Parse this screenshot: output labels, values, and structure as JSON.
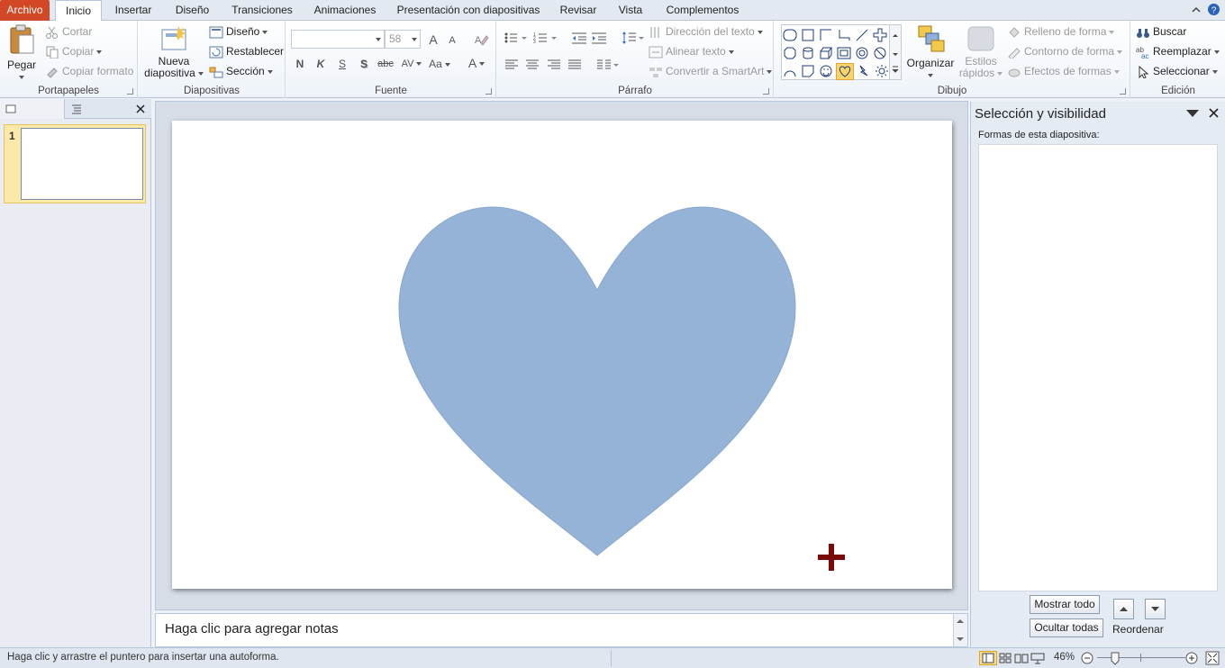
{
  "tabs": {
    "file": "Archivo",
    "home": "Inicio",
    "insert": "Insertar",
    "design": "Diseño",
    "transitions": "Transiciones",
    "animations": "Animaciones",
    "slideshow": "Presentación con diapositivas",
    "review": "Revisar",
    "view": "Vista",
    "addins": "Complementos"
  },
  "clipboard": {
    "paste": "Pegar",
    "cut": "Cortar",
    "copy": "Copiar",
    "format_painter": "Copiar formato",
    "label": "Portapapeles"
  },
  "slides": {
    "new_line1": "Nueva",
    "new_line2": "diapositiva",
    "layout": "Diseño",
    "reset": "Restablecer",
    "section": "Sección",
    "label": "Diapositivas"
  },
  "font": {
    "font_size": "58",
    "bold": "N",
    "italic": "K",
    "underline": "S",
    "shadow": "S",
    "strike": "abc",
    "spacing": "AV",
    "case": "Aa",
    "color": "A",
    "grow": "A",
    "shrink": "A",
    "label": "Fuente"
  },
  "paragraph": {
    "text_direction": "Dirección del texto",
    "align_text": "Alinear texto",
    "smartart": "Convertir a SmartArt",
    "label": "Párrafo"
  },
  "drawing": {
    "arrange": "Organizar",
    "quick_styles_line1": "Estilos",
    "quick_styles_line2": "rápidos",
    "shape_fill": "Relleno de forma",
    "shape_outline": "Contorno de forma",
    "shape_effects": "Efectos de formas",
    "label": "Dibujo"
  },
  "editing": {
    "find": "Buscar",
    "replace": "Reemplazar",
    "select": "Seleccionar",
    "label": "Edición"
  },
  "thumbnails": {
    "slide_number": "1"
  },
  "slide": {
    "heart_fill": "#95b3d7",
    "cursor_color": "#7a0b0b"
  },
  "notes": {
    "placeholder": "Haga clic para agregar notas"
  },
  "selection_pane": {
    "title": "Selección y visibilidad",
    "shapes_label": "Formas de esta diapositiva:",
    "show_all": "Mostrar todo",
    "hide_all": "Ocultar todas",
    "reorder": "Reordenar"
  },
  "status": {
    "message": "Haga clic y arrastre el puntero para insertar una autoforma.",
    "zoom": "46%"
  }
}
